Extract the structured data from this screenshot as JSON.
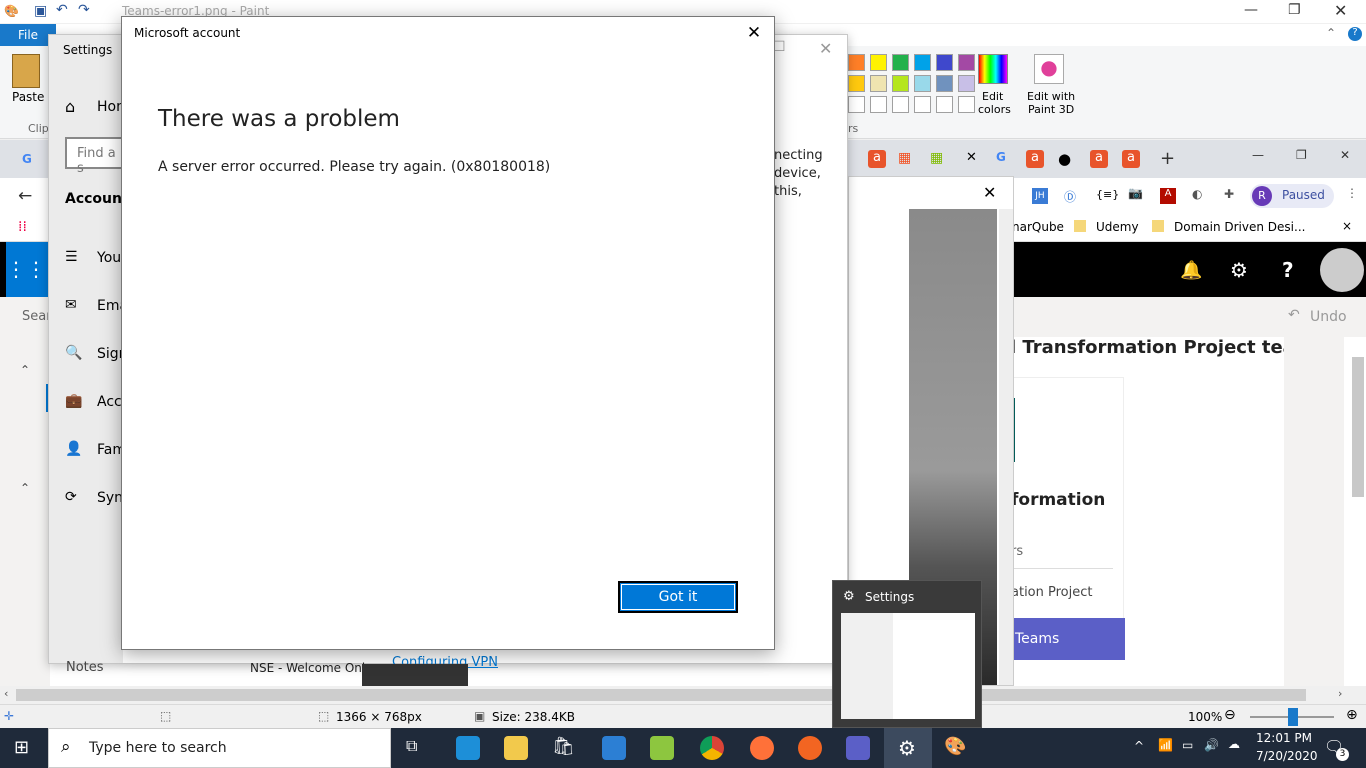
{
  "paint": {
    "title": "Teams-error1.png - Paint",
    "file_tab": "File",
    "ribbon": {
      "paste_label": "Paste",
      "clip_label": "Clip",
      "edit_colors": [
        "Edit",
        "colors"
      ],
      "edit_paint3d": [
        "Edit with",
        "Paint 3D"
      ],
      "colors_group_suffix": "rs"
    },
    "status": {
      "dimensions": "1366 × 768px",
      "size": "Size: 238.4KB",
      "zoom": "100%"
    }
  },
  "chrome": {
    "paused_label": "Paused",
    "avatar_letter": "R",
    "bookmarks": [
      "narQube",
      "Udemy",
      "Domain Driven Desi..."
    ]
  },
  "outlook": {
    "undo_label": "Undo",
    "team_header": "l Transformation Project team!",
    "card_title": "formation",
    "card_line1": "rs",
    "card_line2": "ation Project",
    "teams_button": "Teams",
    "connecting_text": [
      "necting",
      "device,",
      "this,"
    ]
  },
  "settings": {
    "title": "Settings",
    "home": "Hom",
    "search_placeholder": "Find a s",
    "accounts": "Accounts",
    "items": [
      "Your",
      "Ema",
      "Sign",
      "Acce",
      "Fami",
      "Sync"
    ],
    "notes": "Notes",
    "nse": "NSE - Welcome Onbo",
    "configuring": "Configuring VPN",
    "sear": "Sear"
  },
  "dialog": {
    "title": "Microsoft account",
    "heading": "There was a problem",
    "message": "A server error occurred. Please try again. (0x80180018)",
    "button": "Got it"
  },
  "taskbar": {
    "search_placeholder": "Type here to search",
    "time": "12:01 PM",
    "date": "7/20/2020",
    "notification_count": "3",
    "thumbnail_title": "Settings"
  },
  "colors": {
    "accent": "#0078d7",
    "palette": [
      "#ff7f27",
      "#fff200",
      "#22b14c",
      "#00a2e8",
      "#3f48cc",
      "#a349a4",
      "#ffc90e",
      "#efe4b0",
      "#b5e61d",
      "#99d9ea",
      "#7092be",
      "#c8bfe7"
    ]
  }
}
